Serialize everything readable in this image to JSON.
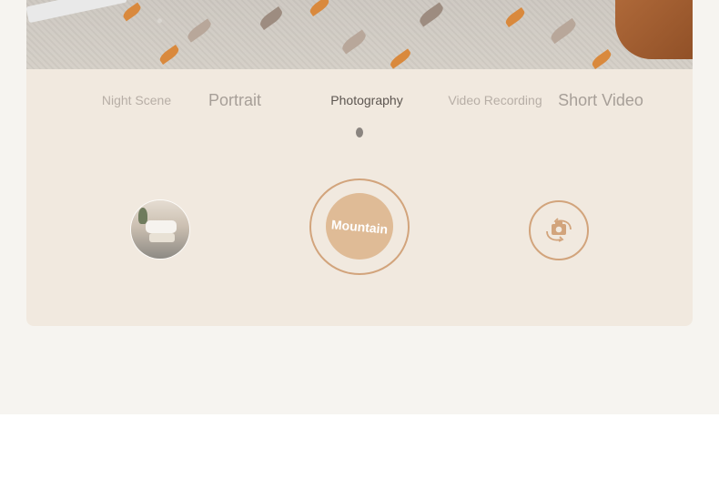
{
  "modes": [
    {
      "label": "Night Scene",
      "size": "small"
    },
    {
      "label": "Portrait",
      "size": "large"
    },
    {
      "label": "Photography",
      "size": "small",
      "active": true
    },
    {
      "label": "Video Recording",
      "size": "small"
    },
    {
      "label": "Short Video",
      "size": "large"
    }
  ],
  "shutter": {
    "label": "Mountain"
  },
  "colors": {
    "accent": "#d2a47c",
    "shutter_fill": "#dfbb96",
    "panel": "#f1e9df",
    "page": "#f6f4f0"
  },
  "icons": {
    "gallery": "gallery-thumbnail-icon",
    "flip": "flip-camera-icon"
  }
}
